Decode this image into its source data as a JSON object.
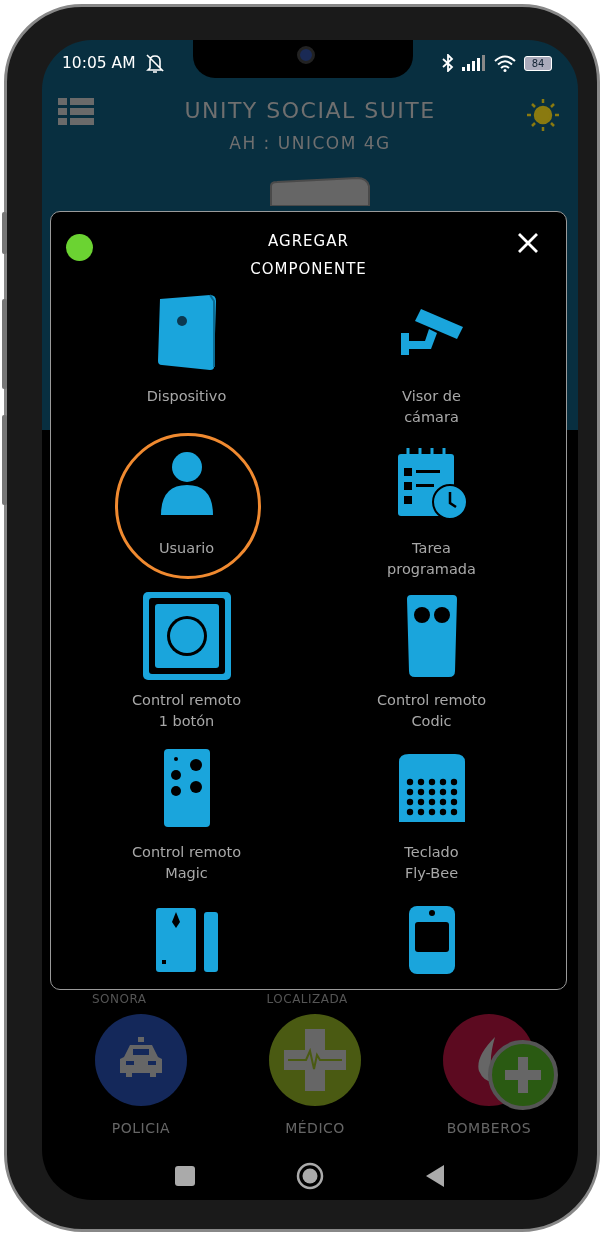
{
  "status_bar": {
    "time": "10:05 AM",
    "battery": "84"
  },
  "header": {
    "title": "UNITY SOCIAL SUITE",
    "subtitle": "AH : UNICOM 4G"
  },
  "background_labels": [
    "SONORA",
    "LOCALIZADA"
  ],
  "emergency_buttons": [
    {
      "kind": "police",
      "label": "POLICIA",
      "color": "#14285a"
    },
    {
      "kind": "medic",
      "label": "MÉDICO",
      "color": "#4a5a12"
    },
    {
      "kind": "fire",
      "label": "BOMBEROS",
      "color": "#5c0a20"
    }
  ],
  "dialog": {
    "connected": true,
    "title_lines": [
      "AGREGAR",
      "COMPONENTE"
    ],
    "components": [
      {
        "kind": "device",
        "label": "Dispositivo",
        "selected": false
      },
      {
        "kind": "camera",
        "label": "Visor de\ncámara",
        "selected": false
      },
      {
        "kind": "user",
        "label": "Usuario",
        "selected": true
      },
      {
        "kind": "calendar",
        "label": "Tarea\nprogramada",
        "selected": false
      },
      {
        "kind": "remote-one",
        "label": "Control remoto\n1 botón",
        "selected": false
      },
      {
        "kind": "remote-codic",
        "label": "Control remoto\nCodic",
        "selected": false
      },
      {
        "kind": "remote-magic",
        "label": "Control remoto\nMagic",
        "selected": false
      },
      {
        "kind": "keypad",
        "label": "Teclado\nFly-Bee",
        "selected": false
      },
      {
        "kind": "door-sensor",
        "selected": false
      },
      {
        "kind": "motion-sensor",
        "selected": false
      }
    ]
  }
}
